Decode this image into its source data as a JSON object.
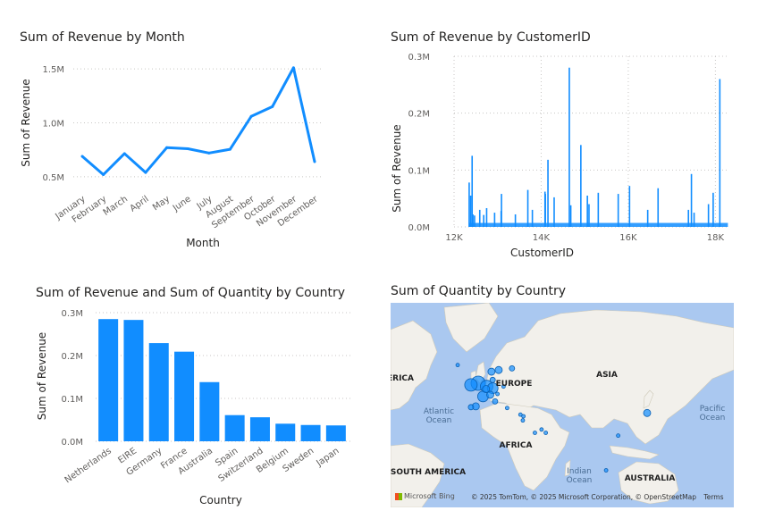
{
  "colors": {
    "accent": "#118DFF",
    "text": "#252423",
    "axis_text": "#605E5C",
    "gridline": "#C8C6C4",
    "map_water": "#AAC8F0",
    "map_land": "#F2F0EB"
  },
  "chart_data": [
    {
      "type": "line",
      "title": "Sum of Revenue by Month",
      "xlabel": "Month",
      "ylabel": "Sum of Revenue",
      "categories": [
        "January",
        "February",
        "March",
        "April",
        "May",
        "June",
        "July",
        "August",
        "September",
        "October",
        "November",
        "December"
      ],
      "values": [
        690000,
        520000,
        715000,
        540000,
        770000,
        760000,
        720000,
        755000,
        1060000,
        1150000,
        1510000,
        640000
      ],
      "ylim": [
        400000,
        1600000
      ],
      "yticks": [
        {
          "value": 500000,
          "label": "0.5M"
        },
        {
          "value": 1000000,
          "label": "1.0M"
        },
        {
          "value": 1500000,
          "label": "1.5M"
        }
      ],
      "grid": true
    },
    {
      "type": "bar",
      "title": "Sum of Revenue by CustomerID",
      "xlabel": "CustomerID",
      "ylabel": "Sum of Revenue",
      "xlim": [
        12000,
        18300
      ],
      "ylim": [
        0,
        300000
      ],
      "xticks": [
        {
          "value": 12000,
          "label": "12K"
        },
        {
          "value": 14000,
          "label": "14K"
        },
        {
          "value": 16000,
          "label": "16K"
        },
        {
          "value": 18000,
          "label": "18K"
        }
      ],
      "yticks": [
        {
          "value": 0,
          "label": "0.0M"
        },
        {
          "value": 100000,
          "label": "0.1M"
        },
        {
          "value": 200000,
          "label": "0.2M"
        },
        {
          "value": 300000,
          "label": "0.3M"
        }
      ],
      "grid": true,
      "x": [
        12347,
        12381,
        12415,
        12433,
        12471,
        12590,
        12681,
        12748,
        12931,
        13081,
        13089,
        13408,
        13694,
        13798,
        14088,
        14096,
        14156,
        14298,
        14646,
        14680,
        14911,
        15061,
        15098,
        15311,
        15769,
        16029,
        16446,
        16684,
        17381,
        17450,
        17511,
        17841,
        17949,
        18102
      ],
      "values": [
        78000,
        55000,
        125000,
        22000,
        20000,
        30000,
        21000,
        33000,
        25000,
        28000,
        58000,
        22000,
        65000,
        30000,
        62000,
        58000,
        118000,
        52000,
        280000,
        38000,
        144000,
        55000,
        40000,
        60000,
        58000,
        72000,
        30000,
        68000,
        30000,
        93000,
        25000,
        40000,
        60000,
        260000
      ]
    },
    {
      "type": "bar",
      "title": "Sum of Revenue and Sum of Quantity by Country",
      "xlabel": "Country",
      "ylabel": "Sum of Revenue",
      "categories": [
        "Netherlands",
        "EIRE",
        "Germany",
        "France",
        "Australia",
        "Spain",
        "Switzerland",
        "Belgium",
        "Sweden",
        "Japan"
      ],
      "values": [
        285000,
        283000,
        229000,
        209000,
        138000,
        61000,
        56000,
        41000,
        38000,
        37000
      ],
      "ylim": [
        0,
        300000
      ],
      "yticks": [
        {
          "value": 0,
          "label": "0.0M"
        },
        {
          "value": 100000,
          "label": "0.1M"
        },
        {
          "value": 200000,
          "label": "0.2M"
        },
        {
          "value": 300000,
          "label": "0.3M"
        }
      ],
      "grid": true
    }
  ],
  "map": {
    "title": "Sum of Quantity by Country",
    "labels": {
      "europe": "EUROPE",
      "asia": "ASIA",
      "america": "ERICA",
      "atlantic": "Atlantic Ocean",
      "africa": "AFRICA",
      "pacific": "Pacific Ocean",
      "indian": "Indian Ocean",
      "south_america": "SOUTH AMERICA",
      "australia": "AUSTRALIA"
    },
    "bing_logo": "Microsoft Bing",
    "attribution": "© 2025 TomTom, © 2025 Microsoft Corporation, © OpenStreetMap",
    "terms": "Terms",
    "bubbles": [
      {
        "country": "United Kingdom",
        "lon": -2,
        "lat": 54,
        "r": 8
      },
      {
        "country": "Netherlands",
        "lon": 5,
        "lat": 52,
        "r": 7
      },
      {
        "country": "EIRE",
        "lon": -8,
        "lat": 53,
        "r": 7
      },
      {
        "country": "Germany",
        "lon": 10,
        "lat": 51,
        "r": 6
      },
      {
        "country": "France",
        "lon": 2,
        "lat": 46,
        "r": 6
      },
      {
        "country": "Switzerland",
        "lon": 8,
        "lat": 47,
        "r": 4
      },
      {
        "country": "Belgium",
        "lon": 4.5,
        "lat": 50.5,
        "r": 4
      },
      {
        "country": "Spain",
        "lon": -4,
        "lat": 40,
        "r": 4
      },
      {
        "country": "Portugal",
        "lon": -8,
        "lat": 39.5,
        "r": 3
      },
      {
        "country": "Sweden",
        "lon": 15,
        "lat": 62,
        "r": 4
      },
      {
        "country": "Norway",
        "lon": 9,
        "lat": 61,
        "r": 4
      },
      {
        "country": "Finland",
        "lon": 26,
        "lat": 63,
        "r": 3
      },
      {
        "country": "Denmark",
        "lon": 10,
        "lat": 56,
        "r": 3
      },
      {
        "country": "Iceland",
        "lon": -19,
        "lat": 65,
        "r": 2
      },
      {
        "country": "Poland",
        "lon": 19,
        "lat": 52,
        "r": 2
      },
      {
        "country": "Austria",
        "lon": 14,
        "lat": 47.5,
        "r": 2
      },
      {
        "country": "Italy",
        "lon": 12,
        "lat": 43,
        "r": 3
      },
      {
        "country": "Greece",
        "lon": 22,
        "lat": 39,
        "r": 2
      },
      {
        "country": "Cyprus",
        "lon": 33,
        "lat": 35,
        "r": 2
      },
      {
        "country": "Lebanon",
        "lon": 35.5,
        "lat": 34,
        "r": 2
      },
      {
        "country": "Israel",
        "lon": 35,
        "lat": 31.5,
        "r": 2
      },
      {
        "country": "United Arab Emirates",
        "lon": 54,
        "lat": 24,
        "r": 2
      },
      {
        "country": "Saudi Arabia",
        "lon": 45,
        "lat": 24,
        "r": 2
      },
      {
        "country": "Bahrain",
        "lon": 50.5,
        "lat": 26,
        "r": 2
      },
      {
        "country": "Japan",
        "lon": 138,
        "lat": 36,
        "r": 4
      },
      {
        "country": "Hong Kong",
        "lon": 114,
        "lat": 22.3,
        "r": 2
      },
      {
        "country": "Singapore",
        "lon": 104,
        "lat": 1.3,
        "r": 2
      },
      {
        "country": "Australia",
        "lon": 134,
        "lat": -25,
        "r": 6
      },
      {
        "country": "South Africa",
        "lon": 24,
        "lat": -29,
        "r": 2
      },
      {
        "country": "Canada",
        "lon": -106,
        "lat": 56,
        "r": 2
      }
    ]
  }
}
